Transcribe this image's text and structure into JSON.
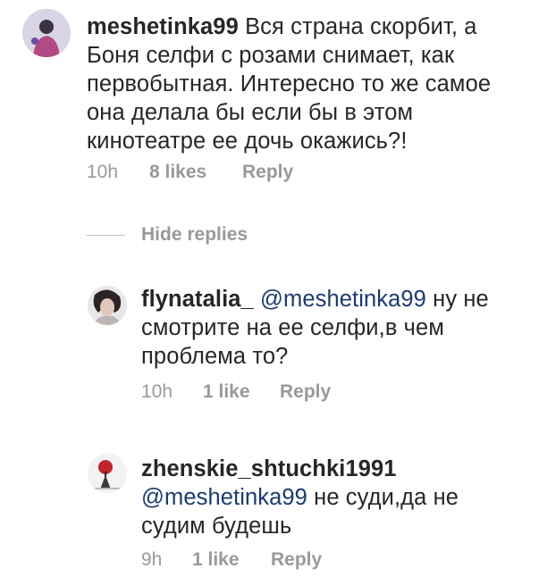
{
  "comments": [
    {
      "username": "meshetinka99",
      "text_line1": " Вся страна скорбит, а",
      "text_line2": "Боня селфи с розами снимает, как",
      "text_line3": "первобытная. Интересно то же самое",
      "text_line4": "она делала бы если бы в этом",
      "text_line5": "кинотеатре ее дочь окажись?!",
      "time": "10h",
      "likes": "8 likes",
      "reply": "Reply"
    }
  ],
  "thread": {
    "hide_replies_label": "Hide replies"
  },
  "replies": [
    {
      "username": "flynatalia_",
      "mention": "@meshetinka99",
      "text_line1_rest": " ну не",
      "text_line2": "смотрите на ее селфи,в чем",
      "text_line3": "проблема то?",
      "time": "10h",
      "likes": "1 like",
      "reply": "Reply"
    },
    {
      "username": "zhenskie_shtuchki1991",
      "mention": "@meshetinka99",
      "text_line2_rest": " не суди,да не",
      "text_line3": "судим будешь",
      "time": "9h",
      "likes": "1 like",
      "reply": "Reply"
    }
  ],
  "colors": {
    "text": "#262626",
    "meta": "#999999",
    "mention": "#1b3b6f"
  }
}
